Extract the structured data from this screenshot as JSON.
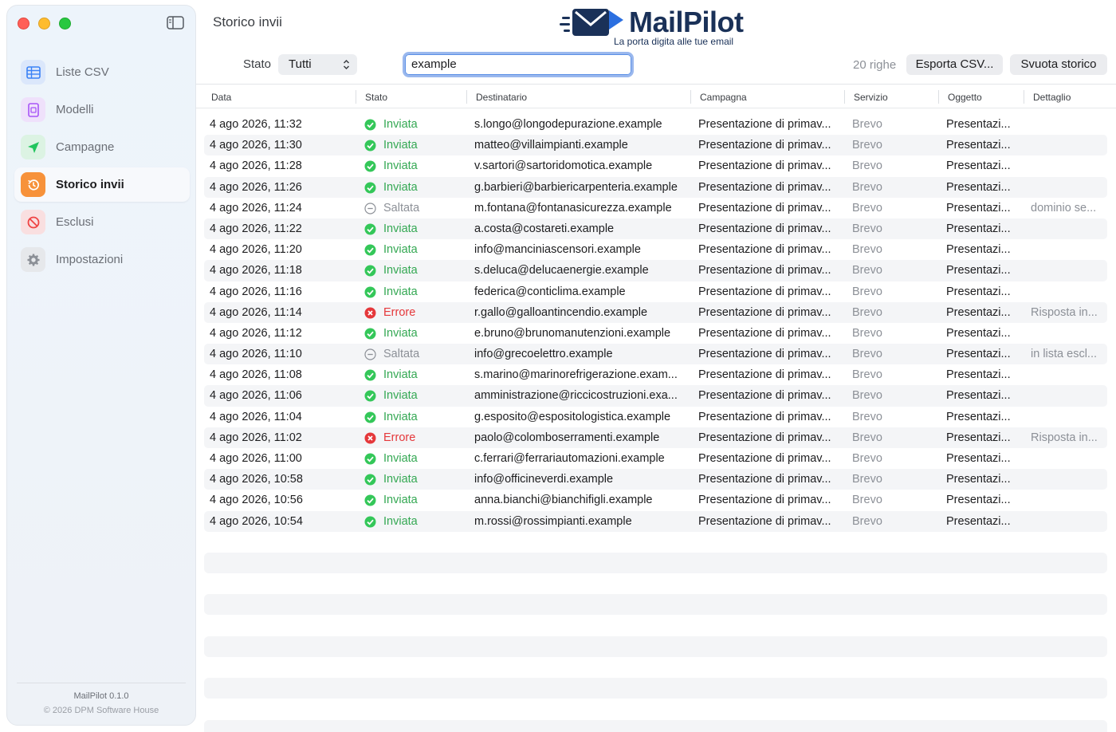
{
  "window": {
    "page_title": "Storico invii"
  },
  "brand": {
    "name_part1": "Mail",
    "name_part2": "Pilot",
    "tagline": "La porta digita alle tue email",
    "color": "#1a3158",
    "accent": "#2b6fe0"
  },
  "sidebar": {
    "items": [
      {
        "label": "Liste CSV",
        "icon": "table-icon",
        "color": "#3b82f6"
      },
      {
        "label": "Modelli",
        "icon": "document-icon",
        "color": "#a855f7"
      },
      {
        "label": "Campagne",
        "icon": "paper-plane-icon",
        "color": "#22c55e"
      },
      {
        "label": "Storico invii",
        "icon": "history-clock-icon",
        "color": "#f97316",
        "active": true
      },
      {
        "label": "Esclusi",
        "icon": "prohibited-icon",
        "color": "#ef4444"
      },
      {
        "label": "Impostazioni",
        "icon": "gear-icon",
        "color": "#9ca3af"
      }
    ],
    "version": "MailPilot 0.1.0",
    "copyright": "© 2026 DPM Software House"
  },
  "toolbar": {
    "status_label": "Stato",
    "status_value": "Tutti",
    "search_value": "example",
    "row_count": "20 righe",
    "export_label": "Esporta CSV...",
    "clear_label": "Svuota storico"
  },
  "table": {
    "columns": [
      "Data",
      "Stato",
      "Destinatario",
      "Campagna",
      "Servizio",
      "Oggetto",
      "Dettaglio"
    ],
    "rows": [
      {
        "date": "4 ago 2026, 11:32",
        "status": "Inviata",
        "kind": "ok",
        "recipient": "s.longo@longodepurazione.example",
        "campaign": "Presentazione di primav...",
        "service": "Brevo",
        "subject": "Presentazi...",
        "detail": ""
      },
      {
        "date": "4 ago 2026, 11:30",
        "status": "Inviata",
        "kind": "ok",
        "recipient": "matteo@villaimpianti.example",
        "campaign": "Presentazione di primav...",
        "service": "Brevo",
        "subject": "Presentazi...",
        "detail": ""
      },
      {
        "date": "4 ago 2026, 11:28",
        "status": "Inviata",
        "kind": "ok",
        "recipient": "v.sartori@sartoridomotica.example",
        "campaign": "Presentazione di primav...",
        "service": "Brevo",
        "subject": "Presentazi...",
        "detail": ""
      },
      {
        "date": "4 ago 2026, 11:26",
        "status": "Inviata",
        "kind": "ok",
        "recipient": "g.barbieri@barbiericarpenteria.example",
        "campaign": "Presentazione di primav...",
        "service": "Brevo",
        "subject": "Presentazi...",
        "detail": ""
      },
      {
        "date": "4 ago 2026, 11:24",
        "status": "Saltata",
        "kind": "skip",
        "recipient": "m.fontana@fontanasicurezza.example",
        "campaign": "Presentazione di primav...",
        "service": "Brevo",
        "subject": "Presentazi...",
        "detail": "dominio se..."
      },
      {
        "date": "4 ago 2026, 11:22",
        "status": "Inviata",
        "kind": "ok",
        "recipient": "a.costa@costareti.example",
        "campaign": "Presentazione di primav...",
        "service": "Brevo",
        "subject": "Presentazi...",
        "detail": ""
      },
      {
        "date": "4 ago 2026, 11:20",
        "status": "Inviata",
        "kind": "ok",
        "recipient": "info@manciniascensori.example",
        "campaign": "Presentazione di primav...",
        "service": "Brevo",
        "subject": "Presentazi...",
        "detail": ""
      },
      {
        "date": "4 ago 2026, 11:18",
        "status": "Inviata",
        "kind": "ok",
        "recipient": "s.deluca@delucaenergie.example",
        "campaign": "Presentazione di primav...",
        "service": "Brevo",
        "subject": "Presentazi...",
        "detail": ""
      },
      {
        "date": "4 ago 2026, 11:16",
        "status": "Inviata",
        "kind": "ok",
        "recipient": "federica@conticlima.example",
        "campaign": "Presentazione di primav...",
        "service": "Brevo",
        "subject": "Presentazi...",
        "detail": ""
      },
      {
        "date": "4 ago 2026, 11:14",
        "status": "Errore",
        "kind": "err",
        "recipient": "r.gallo@galloantincendio.example",
        "campaign": "Presentazione di primav...",
        "service": "Brevo",
        "subject": "Presentazi...",
        "detail": "Risposta in..."
      },
      {
        "date": "4 ago 2026, 11:12",
        "status": "Inviata",
        "kind": "ok",
        "recipient": "e.bruno@brunomanutenzioni.example",
        "campaign": "Presentazione di primav...",
        "service": "Brevo",
        "subject": "Presentazi...",
        "detail": ""
      },
      {
        "date": "4 ago 2026, 11:10",
        "status": "Saltata",
        "kind": "skip",
        "recipient": "info@grecoelettro.example",
        "campaign": "Presentazione di primav...",
        "service": "Brevo",
        "subject": "Presentazi...",
        "detail": "in lista escl..."
      },
      {
        "date": "4 ago 2026, 11:08",
        "status": "Inviata",
        "kind": "ok",
        "recipient": "s.marino@marinorefrigerazione.exam...",
        "campaign": "Presentazione di primav...",
        "service": "Brevo",
        "subject": "Presentazi...",
        "detail": ""
      },
      {
        "date": "4 ago 2026, 11:06",
        "status": "Inviata",
        "kind": "ok",
        "recipient": "amministrazione@riccicostruzioni.exa...",
        "campaign": "Presentazione di primav...",
        "service": "Brevo",
        "subject": "Presentazi...",
        "detail": ""
      },
      {
        "date": "4 ago 2026, 11:04",
        "status": "Inviata",
        "kind": "ok",
        "recipient": "g.esposito@espositologistica.example",
        "campaign": "Presentazione di primav...",
        "service": "Brevo",
        "subject": "Presentazi...",
        "detail": ""
      },
      {
        "date": "4 ago 2026, 11:02",
        "status": "Errore",
        "kind": "err",
        "recipient": "paolo@colomboserramenti.example",
        "campaign": "Presentazione di primav...",
        "service": "Brevo",
        "subject": "Presentazi...",
        "detail": "Risposta in..."
      },
      {
        "date": "4 ago 2026, 11:00",
        "status": "Inviata",
        "kind": "ok",
        "recipient": "c.ferrari@ferrariautomazioni.example",
        "campaign": "Presentazione di primav...",
        "service": "Brevo",
        "subject": "Presentazi...",
        "detail": ""
      },
      {
        "date": "4 ago 2026, 10:58",
        "status": "Inviata",
        "kind": "ok",
        "recipient": "info@officineverdi.example",
        "campaign": "Presentazione di primav...",
        "service": "Brevo",
        "subject": "Presentazi...",
        "detail": ""
      },
      {
        "date": "4 ago 2026, 10:56",
        "status": "Inviata",
        "kind": "ok",
        "recipient": "anna.bianchi@bianchifigli.example",
        "campaign": "Presentazione di primav...",
        "service": "Brevo",
        "subject": "Presentazi...",
        "detail": ""
      },
      {
        "date": "4 ago 2026, 10:54",
        "status": "Inviata",
        "kind": "ok",
        "recipient": "m.rossi@rossimpianti.example",
        "campaign": "Presentazione di primav...",
        "service": "Brevo",
        "subject": "Presentazi...",
        "detail": ""
      }
    ]
  }
}
